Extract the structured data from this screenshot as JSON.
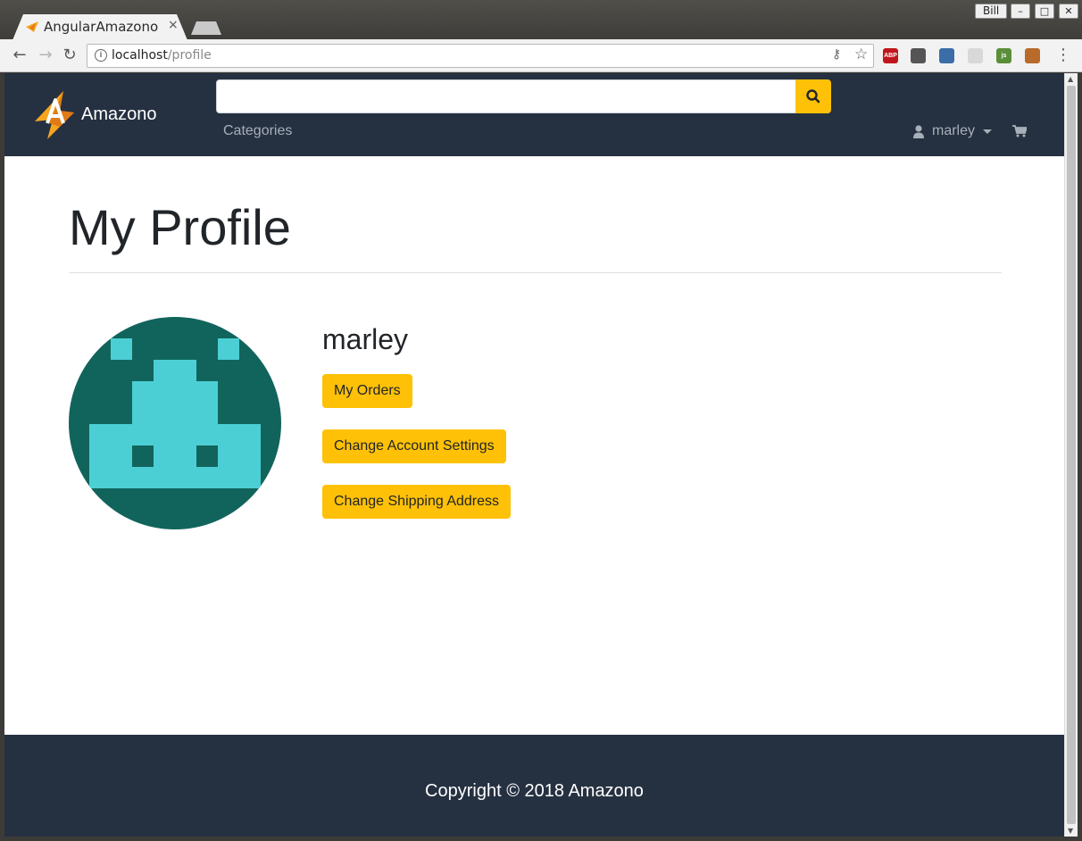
{
  "window": {
    "user": "Bill",
    "controls": {
      "minimize": "–",
      "maximize": "□",
      "close": "✕"
    }
  },
  "tab": {
    "title": "AngularAmazono",
    "close": "×"
  },
  "address_bar": {
    "host": "localhost",
    "path": "/profile"
  },
  "extensions": [
    {
      "name": "adblock-plus-icon",
      "label": "ABP",
      "color": "#c0161b"
    },
    {
      "name": "sync-icon",
      "label": "",
      "color": "#555555"
    },
    {
      "name": "colorzilla-icon",
      "label": "",
      "color": "#3b6ea8"
    },
    {
      "name": "react-devtools-icon",
      "label": "",
      "color": "#d8d8d8"
    },
    {
      "name": "js-icon",
      "label": "js",
      "color": "#5a8f3a"
    },
    {
      "name": "tampermonkey-icon",
      "label": "",
      "color": "#b86b2a"
    }
  ],
  "site": {
    "brand": "Amazono",
    "search": {
      "placeholder": "",
      "value": ""
    },
    "categories": "Categories",
    "user": "marley",
    "colors": {
      "nav": "#253141",
      "accent": "#ffc107"
    }
  },
  "profile": {
    "title": "My Profile",
    "username": "marley",
    "buttons": {
      "orders": "My Orders",
      "settings": "Change Account Settings",
      "address": "Change Shipping Address"
    }
  },
  "footer": {
    "text": "Copyright © 2018 Amazono"
  }
}
